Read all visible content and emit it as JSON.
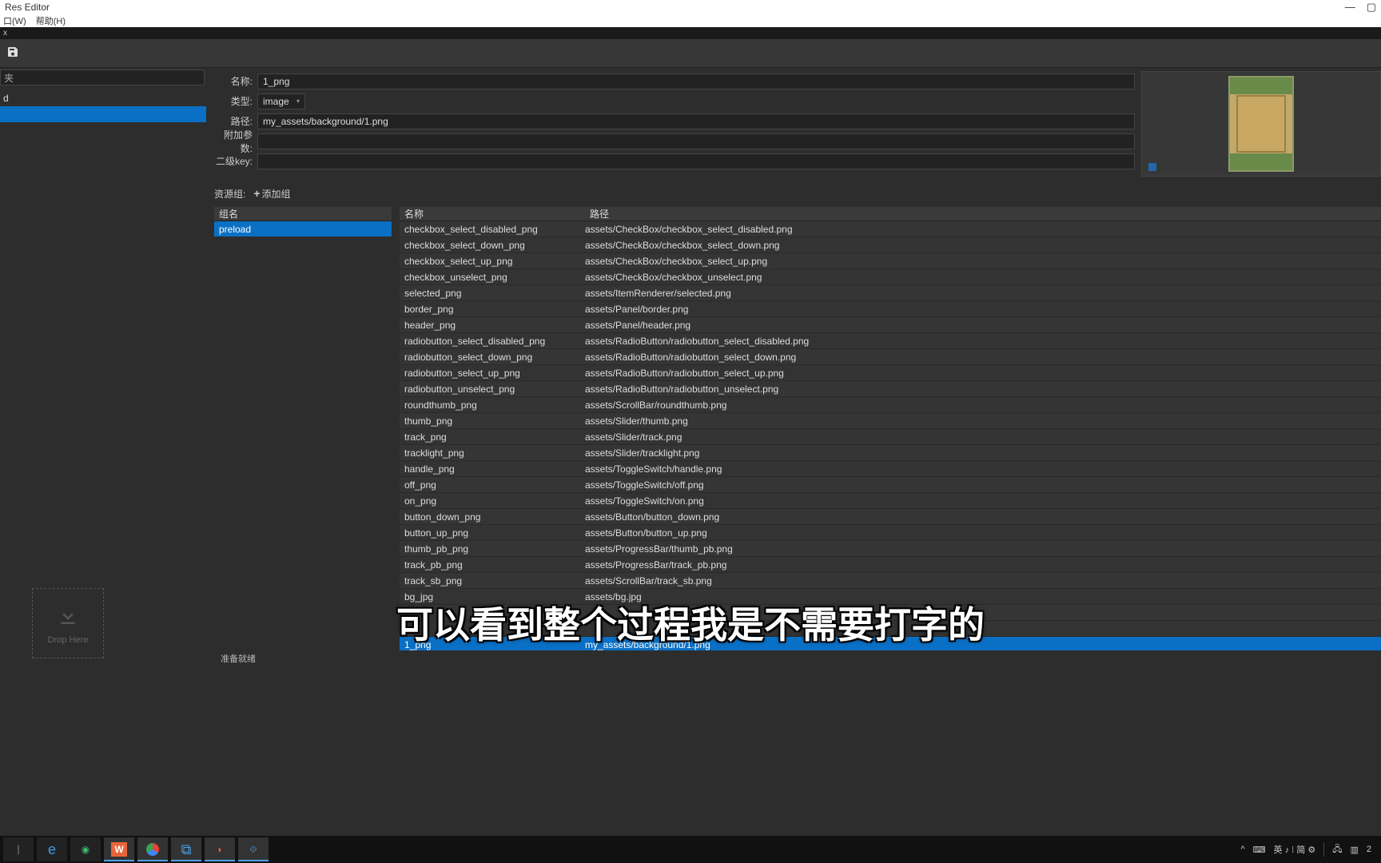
{
  "window": {
    "title": "Res Editor"
  },
  "menubar": {
    "window": "口(W)",
    "help": "帮助(H)"
  },
  "darkrow": {
    "x": "x"
  },
  "sidebar": {
    "search_placeholder": "夹",
    "tree": {
      "root": "d"
    },
    "drop_label": "Drop Here"
  },
  "props": {
    "name_label": "名称:",
    "name_value": "1_png",
    "type_label": "类型:",
    "type_value": "image",
    "path_label": "路径:",
    "path_value": "my_assets/background/1.png",
    "extra_label": "附加参数:",
    "extra_value": "",
    "key2_label": "二级key:",
    "key2_value": ""
  },
  "groups": {
    "label": "资源组:",
    "add_label": "添加组",
    "header": "组名",
    "items": [
      "preload"
    ]
  },
  "files": {
    "header_name": "名称",
    "header_path": "路径",
    "rows": [
      {
        "n": "checkbox_select_disabled_png",
        "p": "assets/CheckBox/checkbox_select_disabled.png"
      },
      {
        "n": "checkbox_select_down_png",
        "p": "assets/CheckBox/checkbox_select_down.png"
      },
      {
        "n": "checkbox_select_up_png",
        "p": "assets/CheckBox/checkbox_select_up.png"
      },
      {
        "n": "checkbox_unselect_png",
        "p": "assets/CheckBox/checkbox_unselect.png"
      },
      {
        "n": "selected_png",
        "p": "assets/ItemRenderer/selected.png"
      },
      {
        "n": "border_png",
        "p": "assets/Panel/border.png"
      },
      {
        "n": "header_png",
        "p": "assets/Panel/header.png"
      },
      {
        "n": "radiobutton_select_disabled_png",
        "p": "assets/RadioButton/radiobutton_select_disabled.png"
      },
      {
        "n": "radiobutton_select_down_png",
        "p": "assets/RadioButton/radiobutton_select_down.png"
      },
      {
        "n": "radiobutton_select_up_png",
        "p": "assets/RadioButton/radiobutton_select_up.png"
      },
      {
        "n": "radiobutton_unselect_png",
        "p": "assets/RadioButton/radiobutton_unselect.png"
      },
      {
        "n": "roundthumb_png",
        "p": "assets/ScrollBar/roundthumb.png"
      },
      {
        "n": "thumb_png",
        "p": "assets/Slider/thumb.png"
      },
      {
        "n": "track_png",
        "p": "assets/Slider/track.png"
      },
      {
        "n": "tracklight_png",
        "p": "assets/Slider/tracklight.png"
      },
      {
        "n": "handle_png",
        "p": "assets/ToggleSwitch/handle.png"
      },
      {
        "n": "off_png",
        "p": "assets/ToggleSwitch/off.png"
      },
      {
        "n": "on_png",
        "p": "assets/ToggleSwitch/on.png"
      },
      {
        "n": "button_down_png",
        "p": "assets/Button/button_down.png"
      },
      {
        "n": "button_up_png",
        "p": "assets/Button/button_up.png"
      },
      {
        "n": "thumb_pb_png",
        "p": "assets/ProgressBar/thumb_pb.png"
      },
      {
        "n": "track_pb_png",
        "p": "assets/ProgressBar/track_pb.png"
      },
      {
        "n": "track_sb_png",
        "p": "assets/ScrollBar/track_sb.png"
      },
      {
        "n": "bg_jpg",
        "p": "assets/bg.jpg"
      },
      {
        "n": "",
        "p": ""
      },
      {
        "n": "",
        "p": ""
      },
      {
        "n": "1_png",
        "p": "my_assets/background/1.png",
        "sel": true
      }
    ]
  },
  "status": {
    "text": "准备就绪"
  },
  "subtitle": "可以看到整个过程我是不需要打字的",
  "tray": {
    "ime": "英 ♪ ⁞ 简 ⚙",
    "time": "2",
    "caret": "^"
  }
}
